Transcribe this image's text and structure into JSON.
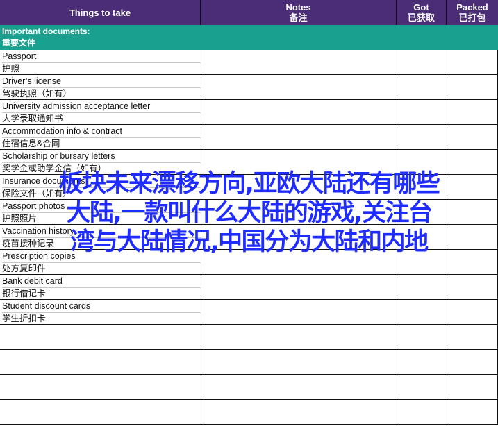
{
  "header": {
    "things": "Things to take",
    "notes_en": "Notes",
    "notes_zh": "备注",
    "got_en": "Got",
    "got_zh": "已获取",
    "packed_en": "Packed",
    "packed_zh": "已打包"
  },
  "section": {
    "title_en": "Important documents:",
    "title_zh": "重要文件"
  },
  "items": [
    {
      "en": "Passport",
      "zh": "护照"
    },
    {
      "en": "Driver’s license",
      "zh": "驾驶执照（如有）"
    },
    {
      "en": "University admission acceptance letter",
      "zh": "大学录取通知书"
    },
    {
      "en": "Accommodation info & contract",
      "zh": "住宿信息&合同"
    },
    {
      "en": "Scholarship or bursary letters",
      "zh": "奖学金或助学金信（如有）"
    },
    {
      "en": "Insurance documents",
      "zh": "保险文件（如有）"
    },
    {
      "en": "Passport photos",
      "zh": "护照照片"
    },
    {
      "en": "Vaccination history",
      "zh": "疫苗接种记录"
    },
    {
      "en": "Prescription copies",
      "zh": "处方复印件"
    },
    {
      "en": "Bank debit card",
      "zh": "银行借记卡"
    },
    {
      "en": "Student discount cards",
      "zh": "学生折扣卡"
    }
  ],
  "overlay_text": {
    "line1": "板块未来漂移方向,亚欧大陆还有哪些",
    "line2": "大陆,一款叫什么大陆的游戏,关注台",
    "line3": "湾与大陆情况,中国分为大陆和内地"
  },
  "colors": {
    "header_bg": "#4b2d77",
    "section_bg": "#1aa08f",
    "overlay_text": "#1f2cff"
  }
}
